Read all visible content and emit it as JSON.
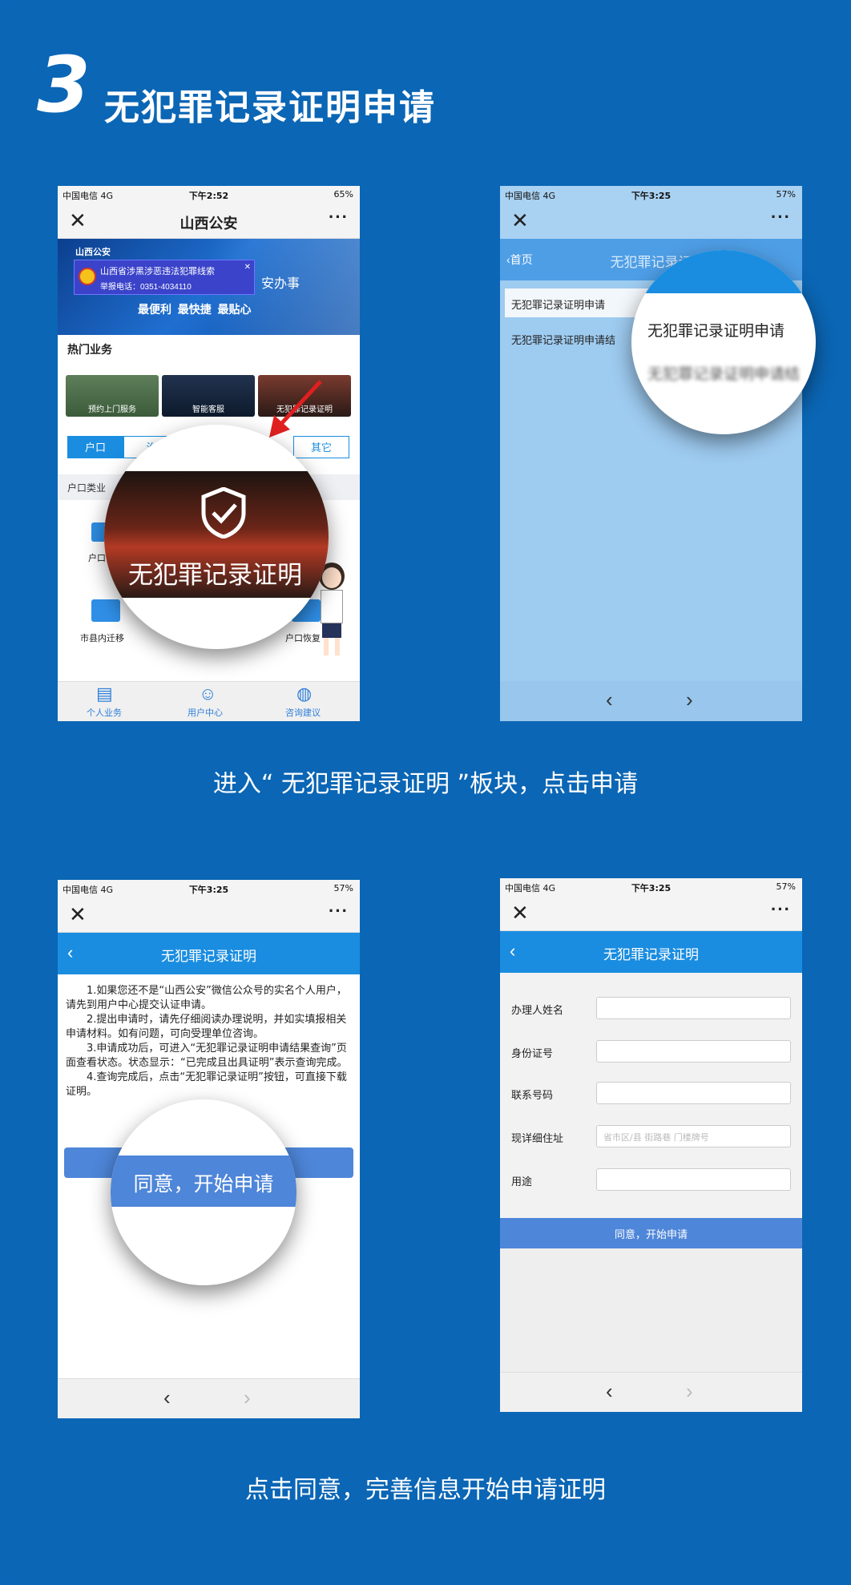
{
  "step": {
    "number": "3",
    "title": "无犯罪记录证明申请"
  },
  "captions": {
    "first": "进入“ 无犯罪记录证明 ”板块，点击申请",
    "second": "点击同意，完善信息开始申请证明"
  },
  "screen1": {
    "status": {
      "carrier": "中国电信 4G",
      "time": "下午2:52",
      "battery": "65%"
    },
    "title": "山西公安",
    "banner": {
      "brand": "山西公安",
      "notice_line1": "山西省涉黑涉恶违法犯罪线索",
      "notice_line2": "举报电话：0351-4034110",
      "partial_text": "安办事",
      "slogan": "最便利  最快捷  最贴心"
    },
    "section_hot": "热门业务",
    "hot_tiles": [
      "预约上门服务",
      "智能客服",
      "无犯罪记录证明"
    ],
    "tabs": [
      "户口",
      "治",
      "其它"
    ],
    "section_hukou": "户口类业",
    "grid_items": [
      "户口",
      "市县内迁移",
      "户口恢复"
    ],
    "magnifier_text": "无犯罪记录证明",
    "nav": [
      "个人业务",
      "用户中心",
      "咨询建议"
    ]
  },
  "screen2": {
    "status": {
      "carrier": "中国电信 4G",
      "time": "下午3:25",
      "battery": "57%"
    },
    "back": "首页",
    "title": "无犯罪记录证",
    "list": [
      "无犯罪记录证明申请",
      "无犯罪记录证明申请结"
    ],
    "magnifier_item1": "无犯罪记录证明申请",
    "magnifier_item2": "无犯罪记录证明申请结"
  },
  "screen3": {
    "status": {
      "carrier": "中国电信 4G",
      "time": "下午3:25",
      "battery": "57%"
    },
    "title": "无犯罪记录证明",
    "paragraphs": [
      "1.如果您还不是“山西公安”微信公众号的实名个人用户，请先到用户中心提交认证申请。",
      "2.提出申请时，请先仔细阅读办理说明，并如实填报相关申请材料。如有问题，可向受理单位咨询。",
      "3.申请成功后，可进入“无犯罪记录证明申请结果查询”页面查看状态。状态显示：“已完成且出具证明”表示查询完成。",
      "4.查询完成后，点击“无犯罪记录证明”按钮，可直接下载证明。"
    ],
    "magnifier_button": "同意，开始申请"
  },
  "screen4": {
    "status": {
      "carrier": "中国电信 4G",
      "time": "下午3:25",
      "battery": "57%"
    },
    "title": "无犯罪记录证明",
    "fields": [
      {
        "label": "办理人姓名",
        "placeholder": ""
      },
      {
        "label": "身份证号",
        "placeholder": ""
      },
      {
        "label": "联系号码",
        "placeholder": ""
      },
      {
        "label": "现详细住址",
        "placeholder": "省市区/县  街路巷  门楼牌号"
      },
      {
        "label": "用途",
        "placeholder": ""
      }
    ],
    "submit": "同意，开始申请"
  },
  "colors": {
    "background": "#0b66b5",
    "accent": "#1a8de0",
    "button": "#4e86d9",
    "arrow": "#e02020"
  }
}
